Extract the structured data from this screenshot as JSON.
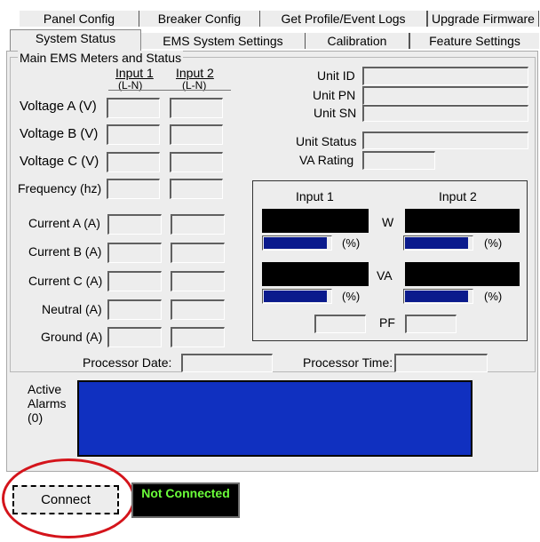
{
  "tabs_row1": [
    "Panel Config",
    "Breaker Config",
    "Get Profile/Event Logs",
    "Upgrade Firmware"
  ],
  "tabs_row2": [
    "System Status",
    "EMS System Settings",
    "Calibration",
    "Feature Settings"
  ],
  "group_title": "Main EMS Meters and Status",
  "input_headers": {
    "input1": "Input 1",
    "input2": "Input 2",
    "mode": "(L-N)"
  },
  "meters": [
    "Voltage A (V)",
    "Voltage B (V)",
    "Voltage C (V)",
    "Frequency (hz)",
    "Current A (A)",
    "Current B (A)",
    "Current C (A)",
    "Neutral (A)",
    "Ground (A)"
  ],
  "unit_fields": [
    "Unit ID",
    "Unit PN",
    "Unit SN",
    "Unit Status",
    "VA Rating"
  ],
  "power_panel": {
    "input1": "Input 1",
    "input2": "Input 2",
    "w_label": "W",
    "va_label": "VA",
    "pf_label": "PF",
    "percent_label": "(%)",
    "bars": {
      "w_input1": 0.95,
      "w_input2": 0.95,
      "va_input1": 0.95,
      "va_input2": 0.95
    }
  },
  "processor": {
    "date_label": "Processor Date:",
    "time_label": "Processor Time:"
  },
  "alarms": {
    "title": "Active",
    "title2": "Alarms",
    "count": "(0)",
    "color": "#1030c0"
  },
  "connect_button": "Connect",
  "connection_status": "Not Connected",
  "status_color": "#6bff3a"
}
